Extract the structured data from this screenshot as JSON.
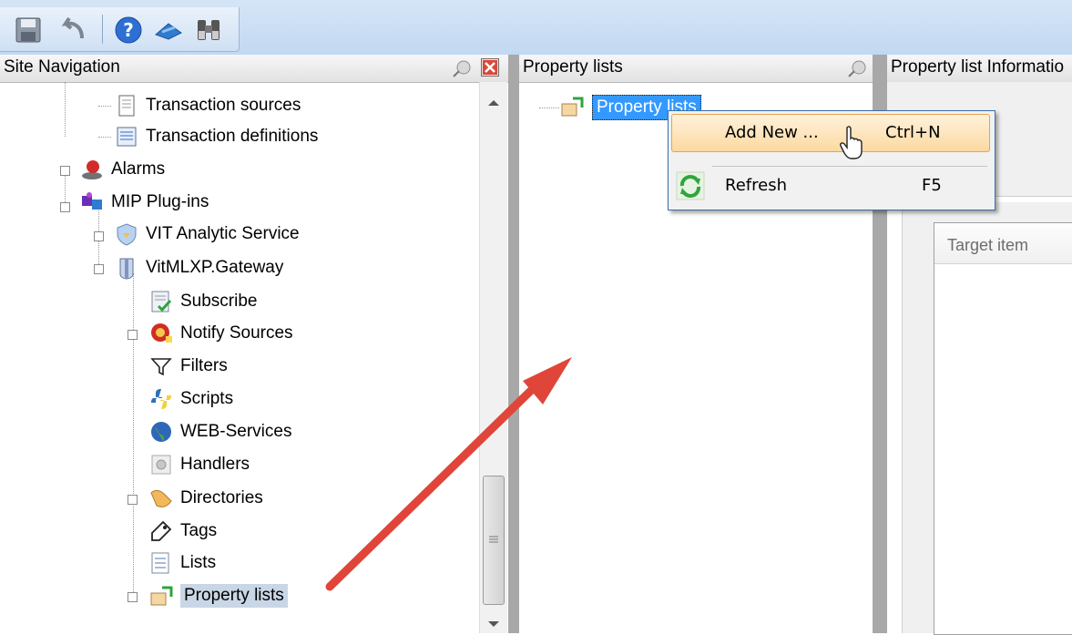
{
  "toolbar": {
    "icons": [
      "save-icon",
      "undo-icon",
      "help-icon",
      "cloud-icon",
      "binoculars-icon"
    ]
  },
  "site_navigation": {
    "title": "Site Navigation",
    "items": [
      {
        "label": "Transaction sources",
        "icon": "document-icon"
      },
      {
        "label": "Transaction definitions",
        "icon": "definitions-icon"
      },
      {
        "label": "Alarms",
        "icon": "alarm-icon"
      },
      {
        "label": "MIP Plug-ins",
        "icon": "plugin-icon"
      },
      {
        "label": "VIT Analytic Service",
        "icon": "shield-icon"
      },
      {
        "label": "VitMLXP.Gateway",
        "icon": "gateway-icon"
      },
      {
        "label": "Subscribe",
        "icon": "subscribe-icon"
      },
      {
        "label": "Notify Sources",
        "icon": "notify-icon"
      },
      {
        "label": "Filters",
        "icon": "filter-icon"
      },
      {
        "label": "Scripts",
        "icon": "python-icon"
      },
      {
        "label": "WEB-Services",
        "icon": "globe-icon"
      },
      {
        "label": "Handlers",
        "icon": "handlers-icon"
      },
      {
        "label": "Directories",
        "icon": "folder-icon"
      },
      {
        "label": "Tags",
        "icon": "tag-icon"
      },
      {
        "label": "Lists",
        "icon": "list-icon"
      },
      {
        "label": "Property lists",
        "icon": "property-list-icon"
      }
    ]
  },
  "property_lists_pane": {
    "title": "Property lists",
    "root_label": "Property lists"
  },
  "context_menu": {
    "items": [
      {
        "label": "Add New ...",
        "shortcut": "Ctrl+N"
      },
      {
        "label": "Refresh",
        "shortcut": "F5"
      }
    ]
  },
  "info_pane": {
    "title": "Property list Informatio",
    "column_header": "Target item"
  },
  "colors": {
    "arrow": "#e0453a",
    "selection": "#3399ff",
    "menu_highlight": "#fcd9a0"
  }
}
